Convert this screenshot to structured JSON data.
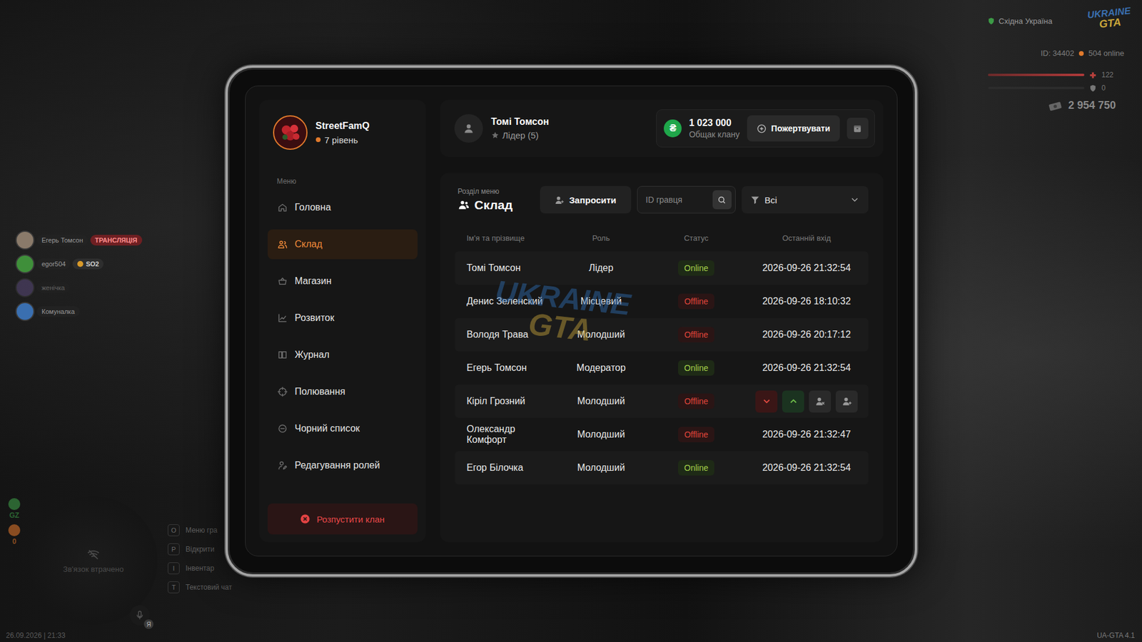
{
  "hud": {
    "region": "Східна Україна",
    "logo": {
      "top": "UKRAINE",
      "bottom": "GTA"
    },
    "player_id": "ID: 34402",
    "online": "504 online",
    "health": {
      "level": 1,
      "reading": "122"
    },
    "armor": {
      "level": 0,
      "reading": "0"
    },
    "money": "2 954 750",
    "voice": [
      {
        "name": "Егерь Томсон",
        "badge": "ТРАНСЛЯЦІЯ",
        "kind": "live",
        "faded": false,
        "avatar_color": "#8a7a6a"
      },
      {
        "name": "egor504",
        "badge": "SO2",
        "kind": "tag",
        "faded": false,
        "avatar_color": "#3f8f3a"
      },
      {
        "name": "женічка",
        "kind": "plain",
        "faded": true,
        "avatar_color": "#5a4a7a"
      },
      {
        "name": "Комуналка",
        "kind": "plain",
        "faded": false,
        "avatar_color": "#3a6fb0"
      }
    ],
    "indicators": [
      {
        "label": "GZ",
        "color": "#3c9a46"
      },
      {
        "label": "0",
        "color": "#d7722a"
      }
    ],
    "minimap": {
      "text": "Зв'язок втрачено"
    },
    "mic_badge": "Я",
    "hints": [
      {
        "key": "O",
        "label": "Меню гра"
      },
      {
        "key": "P",
        "label": "Відкрити"
      },
      {
        "key": "I",
        "label": "Інвентар"
      },
      {
        "key": "T",
        "label": "Текстовий чат"
      }
    ],
    "datetime": "26.09.2026 | 21:33",
    "version": "UA-GTA 4.1"
  },
  "watermark": {
    "top": "UKRAINE",
    "bottom": "GTA"
  },
  "clan": {
    "name": "StreetFamQ",
    "level": "7 рівень"
  },
  "sidebar": {
    "label": "Меню",
    "items": [
      {
        "label": "Головна",
        "selected": false
      },
      {
        "label": "Склад",
        "selected": true
      },
      {
        "label": "Магазин",
        "selected": false
      },
      {
        "label": "Розвиток",
        "selected": false
      },
      {
        "label": "Журнал",
        "selected": false
      },
      {
        "label": "Полювання",
        "selected": false
      },
      {
        "label": "Чорний список",
        "selected": false
      },
      {
        "label": "Редагування ролей",
        "selected": false
      }
    ],
    "disband": "Розпустити клан"
  },
  "user": {
    "name": "Томі Томсон",
    "role": "Лідер (5)"
  },
  "treasury": {
    "currency": "₴",
    "amount": "1 023 000",
    "label": "Общак клану",
    "donate": "Пожертвувати"
  },
  "section": {
    "caption": "Розділ меню",
    "title": "Склад"
  },
  "toolbar": {
    "invite": "Запросити",
    "search_placeholder": "ID гравця",
    "filter": "Всі"
  },
  "table": {
    "columns": [
      "Ім'я та прізвище",
      "Роль",
      "Статус",
      "Останній вхід"
    ],
    "rows": [
      {
        "name": "Томі Томсон",
        "role": "Лідер",
        "status": "Online",
        "online": true,
        "last_login": "2026-09-26 21:32:54",
        "hovered": false
      },
      {
        "name": "Денис Зеленский",
        "role": "Місцевий",
        "status": "Offline",
        "online": false,
        "last_login": "2026-09-26 18:10:32",
        "hovered": false
      },
      {
        "name": "Володя Трава",
        "role": "Молодший",
        "status": "Offline",
        "online": false,
        "last_login": "2026-09-26 20:17:12",
        "hovered": false
      },
      {
        "name": "Егерь Томсон",
        "role": "Модератор",
        "status": "Online",
        "online": true,
        "last_login": "2026-09-26 21:32:54",
        "hovered": false
      },
      {
        "name": "Кіріл Грозний",
        "role": "Молодший",
        "status": "Offline",
        "online": false,
        "hovered": true
      },
      {
        "name": "Олександр Комфорт",
        "role": "Молодший",
        "status": "Offline",
        "online": false,
        "last_login": "2026-09-26 21:32:47",
        "hovered": false
      },
      {
        "name": "Егор Білочка",
        "role": "Молодший",
        "status": "Online",
        "online": true,
        "last_login": "2026-09-26 21:32:54",
        "hovered": false
      }
    ]
  }
}
